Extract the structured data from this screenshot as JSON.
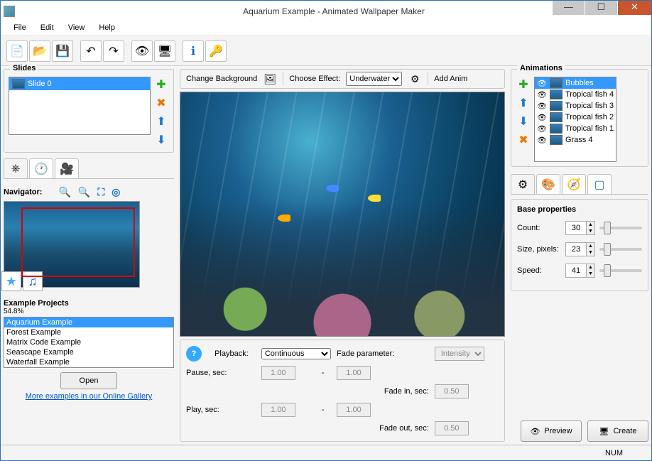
{
  "window": {
    "title": "Aquarium Example - Animated Wallpaper Maker"
  },
  "menu": {
    "file": "File",
    "edit": "Edit",
    "view": "View",
    "help": "Help"
  },
  "slides": {
    "legend": "Slides",
    "items": [
      {
        "label": "Slide 0"
      }
    ]
  },
  "leftnav": {
    "label": "Navigator:"
  },
  "projects": {
    "header": "Example Projects",
    "progress": "54.8%",
    "items": [
      "Aquarium Example",
      "Forest Example",
      "Matrix Code Example",
      "Seascape Example",
      "Waterfall Example"
    ],
    "open": "Open",
    "link": "More examples in our Online Gallery"
  },
  "midbar": {
    "changebg": "Change Background",
    "chooseeffect": "Choose Effect:",
    "effect_value": "Underwater",
    "addanim": "Add Anim"
  },
  "playback": {
    "label": "Playback:",
    "mode": "Continuous",
    "pause": "Pause, sec:",
    "play": "Play, sec:",
    "pause_a": "1.00",
    "pause_b": "1.00",
    "play_a": "1.00",
    "play_b": "1.00",
    "fadeparam": "Fade parameter:",
    "fadeparam_v": "Intensity",
    "fadein": "Fade in, sec:",
    "fadein_v": "0.50",
    "fadeout": "Fade out, sec:",
    "fadeout_v": "0.50",
    "dash": "-"
  },
  "animations": {
    "legend": "Animations",
    "items": [
      "Bubbles",
      "Tropical fish 4",
      "Tropical fish 3",
      "Tropical fish 2",
      "Tropical fish 1",
      "Grass 4"
    ]
  },
  "props": {
    "header": "Base properties",
    "count": "Count:",
    "count_v": "30",
    "size": "Size, pixels:",
    "size_v": "23",
    "speed": "Speed:",
    "speed_v": "41"
  },
  "footer": {
    "preview": "Preview",
    "create": "Create"
  },
  "status": {
    "num": "NUM"
  }
}
